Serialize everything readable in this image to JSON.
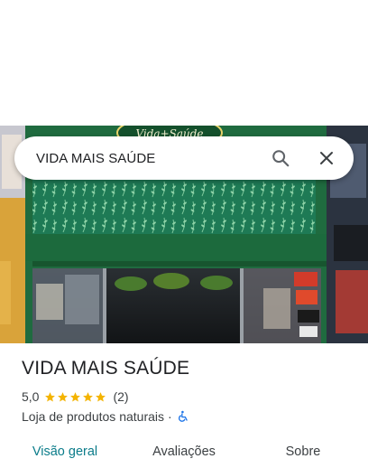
{
  "search": {
    "value": "VIDA MAIS SAÚDE"
  },
  "photo": {
    "sign_text": "Vida+Saúde"
  },
  "place": {
    "name": "VIDA MAIS SAÚDE",
    "rating": "5,0",
    "stars": 5,
    "review_count": "(2)",
    "category": "Loja de produtos naturais",
    "separator": "·",
    "accessibility_icon": "wheelchair-icon"
  },
  "tabs": [
    {
      "label": "Visão geral",
      "active": true
    },
    {
      "label": "Avaliações",
      "active": false
    },
    {
      "label": "Sobre",
      "active": false
    }
  ],
  "colors": {
    "accent": "#0b7c8a",
    "star": "#f4b400",
    "accessibility": "#1a73e8",
    "storefront": "#1f6b3f"
  }
}
